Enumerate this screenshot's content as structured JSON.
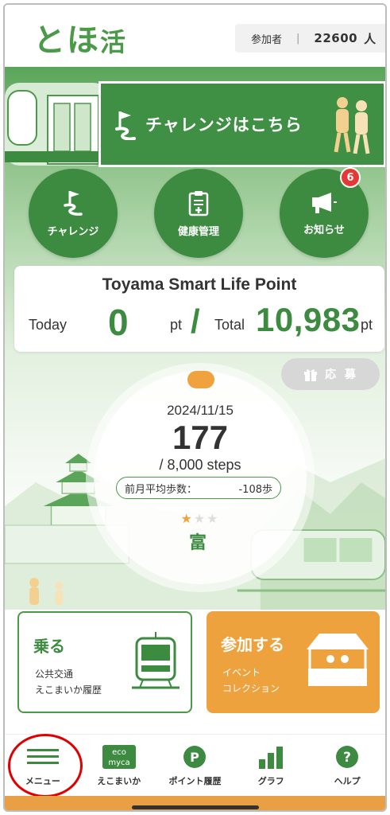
{
  "header": {
    "logo_main": "とほ",
    "logo_sub": "活",
    "participants_label": "参加者",
    "participants_separator": "|",
    "participants_count": "22600",
    "participants_unit": "人"
  },
  "banner": {
    "text": "チャレンジはこちら"
  },
  "quick_menu": [
    {
      "label": "チャレンジ",
      "icon": "flag-icon"
    },
    {
      "label": "健康管理",
      "icon": "clipboard-icon"
    },
    {
      "label": "お知らせ",
      "icon": "megaphone-icon",
      "badge": "6"
    }
  ],
  "points": {
    "title": "Toyama Smart Life Point",
    "today_label": "Today",
    "today_value": "0",
    "unit": "pt",
    "slash": "/",
    "total_label": "Total",
    "total_value": "10,983"
  },
  "apply_button": {
    "label": "応 募",
    "icon": "gift-icon"
  },
  "steps": {
    "date": "2024/11/15",
    "count": "177",
    "goal": "/ 8,000 steps",
    "avg_label": "前月平均歩数：",
    "avg_value": "-108歩",
    "stars_filled": 1,
    "stars_total": 3,
    "mascot_char": "富"
  },
  "cards": {
    "ride": {
      "title": "乗る",
      "line1": "公共交通",
      "line2": "えこまいか履歴",
      "icon": "tram-icon"
    },
    "join": {
      "title": "参加する",
      "line1": "イベント",
      "line2": "コレクション",
      "icon": "tent-icon"
    }
  },
  "bottom_nav": [
    {
      "label": "メニュー",
      "icon": "hamburger-icon"
    },
    {
      "label": "えこまいか",
      "icon": "ecomyca-icon",
      "icon_text_1": "eco",
      "icon_text_2": "myca"
    },
    {
      "label": "ポイント履歴",
      "icon": "point-icon",
      "icon_text": "P"
    },
    {
      "label": "グラフ",
      "icon": "bar-chart-icon"
    },
    {
      "label": "ヘルプ",
      "icon": "help-icon",
      "icon_text": "?"
    }
  ],
  "colors": {
    "primary_green": "#3d8b41",
    "accent_orange": "#eea23e",
    "badge_red": "#e53935",
    "highlight_red": "#e00000"
  }
}
